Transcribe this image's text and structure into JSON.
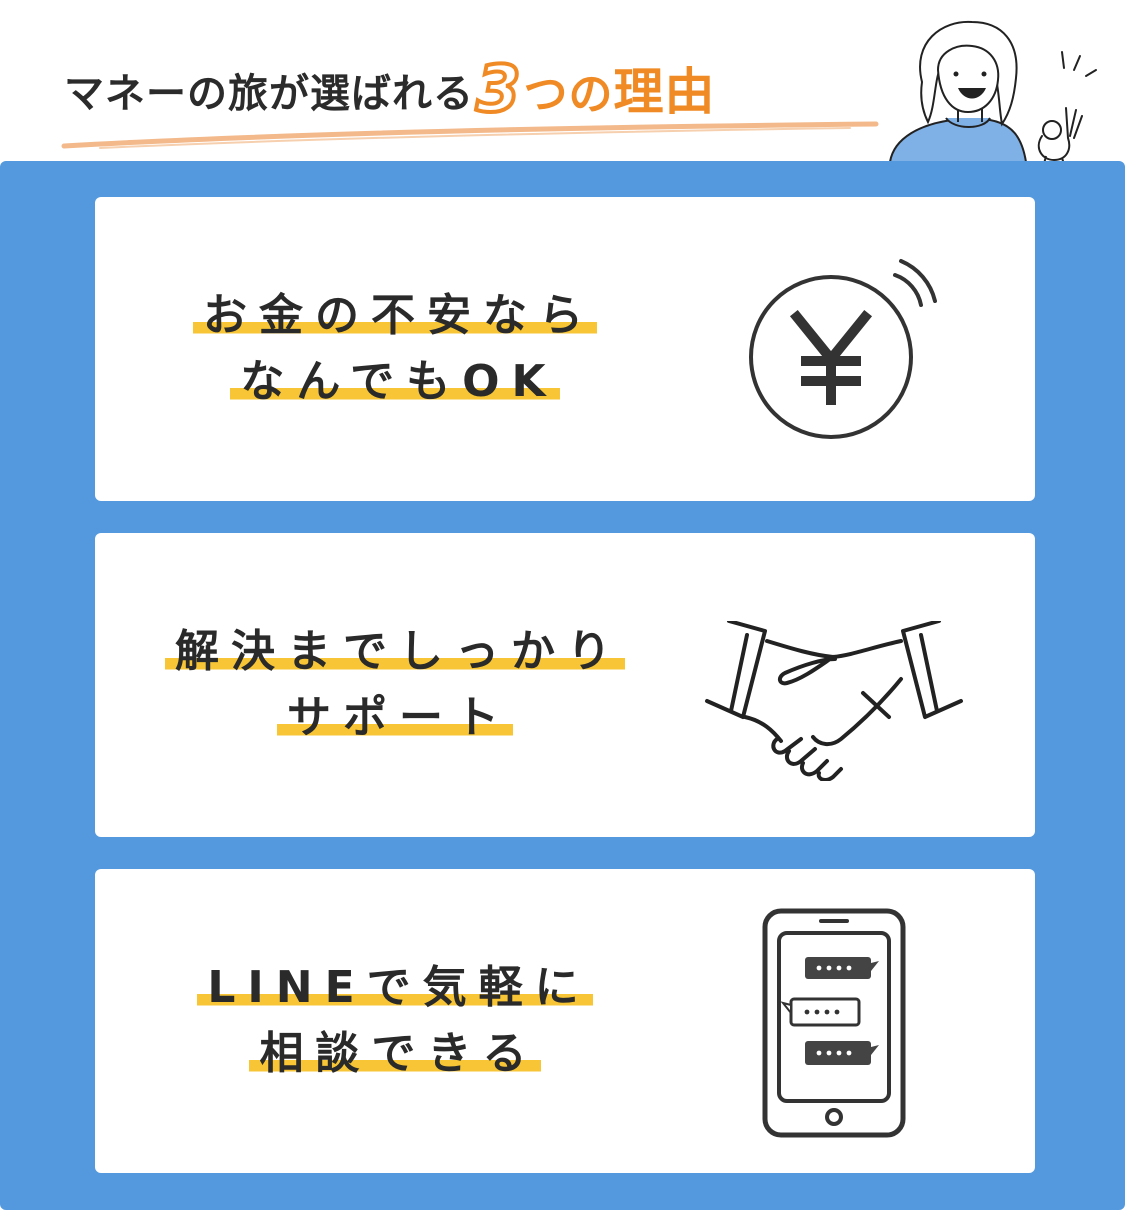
{
  "header": {
    "title_prefix": "マネーの旅が選ばれる",
    "title_number": "3",
    "title_tsu": "つの",
    "title_suffix": "理由"
  },
  "colors": {
    "panel_blue": "#5499dd",
    "accent_orange": "#f08a24",
    "highlight_yellow": "#f7c535",
    "text_dark": "#2a2a2a"
  },
  "reasons": [
    {
      "lines": [
        "お金の不安なら",
        "なんでもOK"
      ],
      "icon": "yen-coin-icon"
    },
    {
      "lines": [
        "解決までしっかり",
        "サポート"
      ],
      "icon": "handshake-icon"
    },
    {
      "lines": [
        "LINEで気軽に",
        "相談できる"
      ],
      "icon": "smartphone-chat-icon"
    }
  ]
}
